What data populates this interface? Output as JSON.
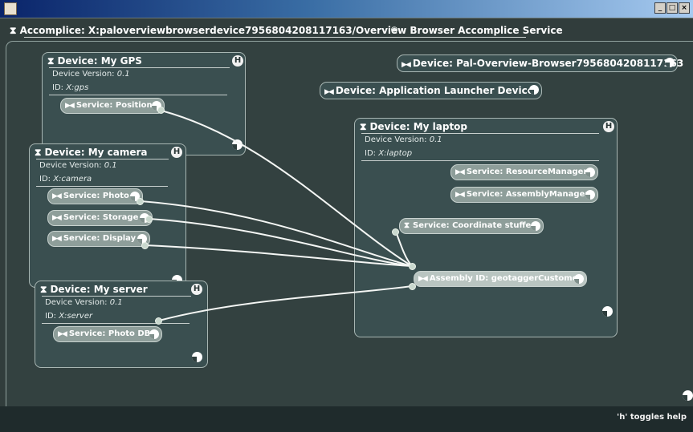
{
  "window": {
    "icon": "java-icon",
    "buttons": [
      "_",
      "□",
      "×"
    ]
  },
  "accomplice": {
    "title": "Accomplice: X:paloverviewbrowserdevice7956804208117163/Overview Browser Accomplice Service"
  },
  "devices": {
    "gps": {
      "title": "Device: My GPS",
      "version_label": "Device Version: ",
      "version": "0.1",
      "id_label": "ID: ",
      "id": "X:gps",
      "badge": "H",
      "service": "Service: Position"
    },
    "camera": {
      "title": "Device: My camera",
      "version_label": "Device Version: ",
      "version": "0.1",
      "id_label": "ID: ",
      "id": "X:camera",
      "badge": "H",
      "services": [
        "Service: Photo",
        "Service: Storage",
        "Service: Display"
      ]
    },
    "server": {
      "title": "Device: My server",
      "version_label": "Device Version: ",
      "version": "0.1",
      "id_label": "ID: ",
      "id": "X:server",
      "badge": "H",
      "service": "Service: Photo DB"
    },
    "laptop": {
      "title": "Device: My laptop",
      "version_label": "Device Version: ",
      "version": "0.1",
      "id_label": "ID: ",
      "id": "X:laptop",
      "badge": "H",
      "services": [
        "Service: ResourceManager",
        "Service: AssemblyManager"
      ],
      "coordinate": "Service: Coordinate stuffer",
      "assembly": "Assembly ID: geotaggerCustomer"
    },
    "pal_browser": {
      "title": "Device: Pal-Overview-Browser7956804208117163",
      "plus": "⊕"
    },
    "launcher": {
      "title": "Device: Application Launcher Device"
    }
  },
  "status": {
    "help_hint": "'h' toggles help"
  },
  "colors": {
    "canvas": "#313d3c",
    "device_panel": "#3a4f50",
    "service_pill": "#8e9e9a",
    "wire": "#f4f6f4",
    "statusbar": "#1f2b2c"
  }
}
